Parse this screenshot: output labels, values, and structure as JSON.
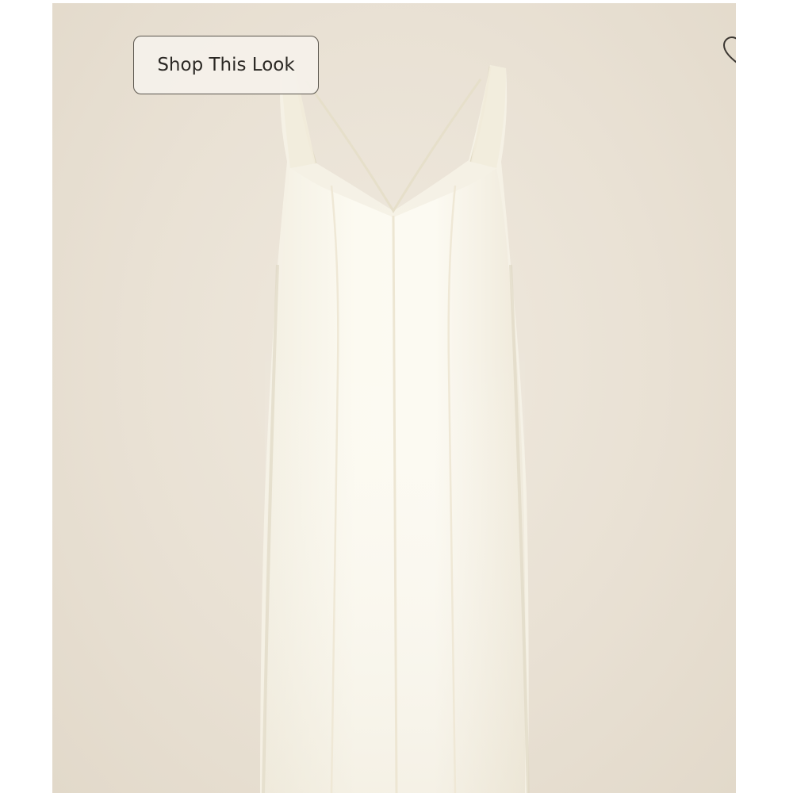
{
  "product_card": {
    "shop_look_label": "Shop This Look",
    "favorite_icon": "heart-outline-icon",
    "background_color": "#ebe4d8",
    "garment_color": "#fbf8ee"
  }
}
